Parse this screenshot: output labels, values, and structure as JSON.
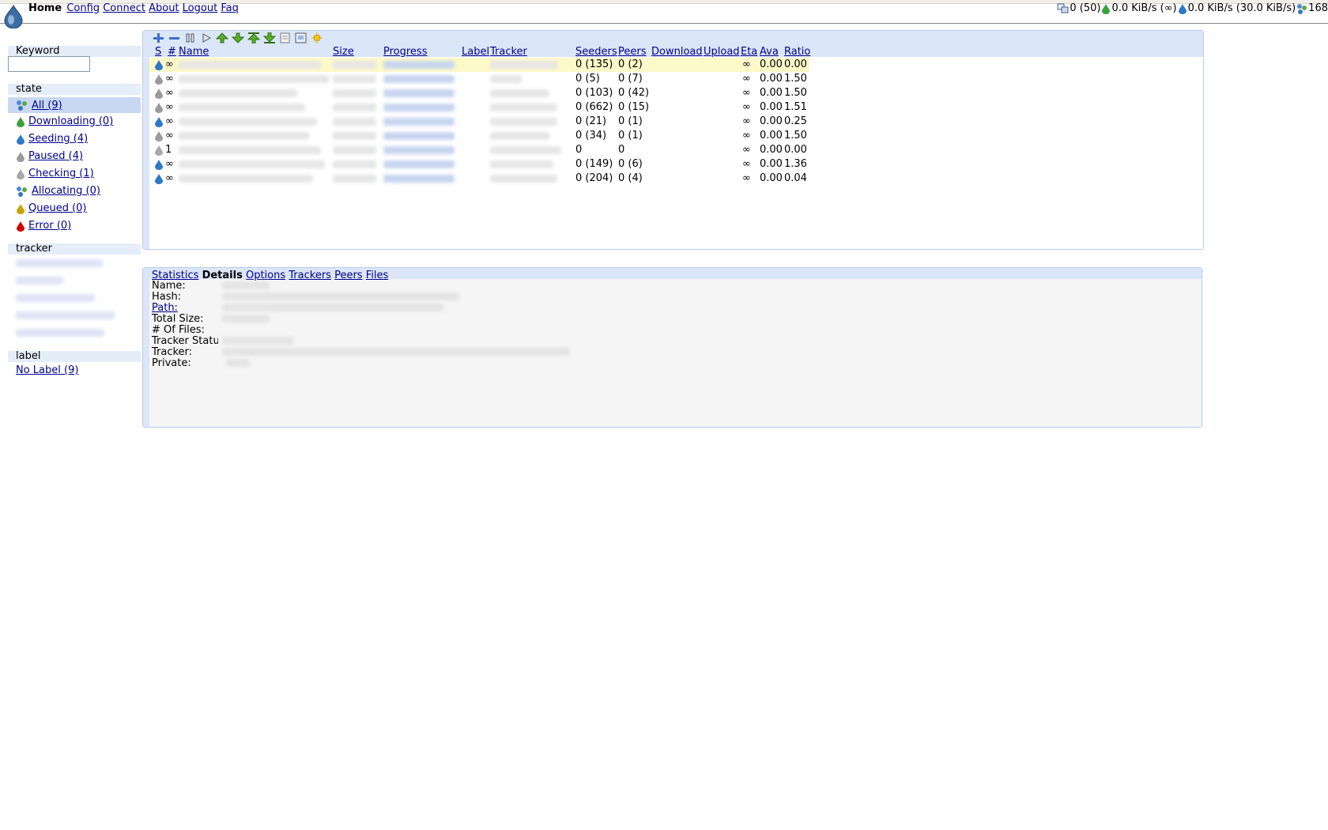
{
  "nav": {
    "home": "Home",
    "config": "Config",
    "connect": "Connect",
    "about": "About",
    "logout": "Logout",
    "faq": "Faq"
  },
  "status": {
    "connections": "0 (50)",
    "download": "0.0 KiB/s (∞)",
    "upload": "0.0 KiB/s (30.0 KiB/s)",
    "dht": "168"
  },
  "sidebar": {
    "keyword_label": "Keyword",
    "state_label": "state",
    "states": [
      {
        "label": "All (9)",
        "icon": "all-icon"
      },
      {
        "label": "Downloading (0)",
        "icon": "downloading-icon"
      },
      {
        "label": "Seeding (4)",
        "icon": "seeding-icon"
      },
      {
        "label": "Paused (4)",
        "icon": "paused-icon"
      },
      {
        "label": "Checking (1)",
        "icon": "checking-icon"
      },
      {
        "label": "Allocating (0)",
        "icon": "allocating-icon"
      },
      {
        "label": "Queued (0)",
        "icon": "queued-icon"
      },
      {
        "label": "Error (0)",
        "icon": "error-icon"
      }
    ],
    "tracker_label": "tracker",
    "label_label": "label",
    "labels": [
      {
        "label": "No Label (9)"
      }
    ]
  },
  "table": {
    "headers": {
      "s": "S",
      "num": "#",
      "name": "Name",
      "size": "Size",
      "progress": "Progress",
      "label": "Label",
      "tracker": "Tracker",
      "seeders": "Seeders",
      "peers": "Peers",
      "download": "Download",
      "upload": "Upload",
      "eta": "Eta",
      "ava": "Ava",
      "ratio": "Ratio"
    },
    "rows": [
      {
        "state": "seeding",
        "num": "∞",
        "seeders": "0 (135)",
        "peers": "0 (2)",
        "eta": "∞",
        "ava": "0.00",
        "ratio": "0.00"
      },
      {
        "state": "paused",
        "num": "∞",
        "seeders": "0 (5)",
        "peers": "0 (7)",
        "eta": "∞",
        "ava": "0.00",
        "ratio": "1.50"
      },
      {
        "state": "paused",
        "num": "∞",
        "seeders": "0 (103)",
        "peers": "0 (42)",
        "eta": "∞",
        "ava": "0.00",
        "ratio": "1.50"
      },
      {
        "state": "paused",
        "num": "∞",
        "seeders": "0 (662)",
        "peers": "0 (15)",
        "eta": "∞",
        "ava": "0.00",
        "ratio": "1.51"
      },
      {
        "state": "seeding",
        "num": "∞",
        "seeders": "0 (21)",
        "peers": "0 (1)",
        "eta": "∞",
        "ava": "0.00",
        "ratio": "0.25"
      },
      {
        "state": "paused",
        "num": "∞",
        "seeders": "0 (34)",
        "peers": "0 (1)",
        "eta": "∞",
        "ava": "0.00",
        "ratio": "1.50"
      },
      {
        "state": "checking",
        "num": "1",
        "seeders": "0",
        "peers": "0",
        "eta": "∞",
        "ava": "0.00",
        "ratio": "0.00"
      },
      {
        "state": "seeding",
        "num": "∞",
        "seeders": "0 (149)",
        "peers": "0 (6)",
        "eta": "∞",
        "ava": "0.00",
        "ratio": "1.36"
      },
      {
        "state": "seeding",
        "num": "∞",
        "seeders": "0 (204)",
        "peers": "0 (4)",
        "eta": "∞",
        "ava": "0.00",
        "ratio": "0.04"
      }
    ]
  },
  "details": {
    "tabs": {
      "statistics": "Statistics",
      "details": "Details",
      "options": "Options",
      "trackers": "Trackers",
      "peers": "Peers",
      "files": "Files"
    },
    "fields": {
      "name": "Name:",
      "hash": "Hash:",
      "path": "Path:",
      "total_size": "Total Size:",
      "num_files": "# Of Files:",
      "tracker_status": "Tracker Statu",
      "tracker": "Tracker:",
      "private": "Private:"
    }
  },
  "colors": {
    "panel_bg": "#dbe6f8",
    "selected_bg": "#c8d8f2",
    "highlight_row": "#fdf9c9",
    "link": "#00008b"
  }
}
